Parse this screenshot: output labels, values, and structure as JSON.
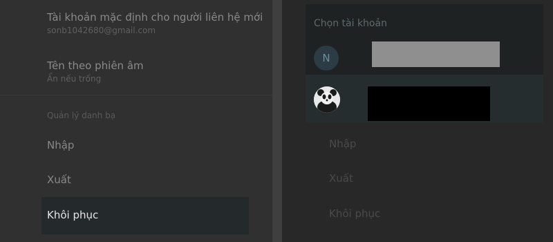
{
  "settings": {
    "default_account": {
      "title": "Tài khoản mặc định cho người liên hệ mới",
      "value": "sonb1042680@gmail.com"
    },
    "phonetic_name": {
      "title": "Tên theo phiên âm",
      "value": "Ẩn nếu trống"
    },
    "manage_section": "Quản lý danh bạ",
    "menu": {
      "import": "Nhập",
      "export": "Xuất",
      "restore": "Khôi phục"
    }
  },
  "dialog": {
    "title": "Chọn tài khoản",
    "accounts": [
      {
        "avatar_letter": "N",
        "avatar_color": "#2c3c44"
      },
      {
        "avatar_icon": "panda-avatar-icon"
      }
    ]
  },
  "background_menu": {
    "import": "Nhập",
    "export": "Xuất",
    "restore": "Khôi phục"
  },
  "colors": {
    "selected_row": "#242a2b",
    "dialog_bg": "#1f2222"
  }
}
